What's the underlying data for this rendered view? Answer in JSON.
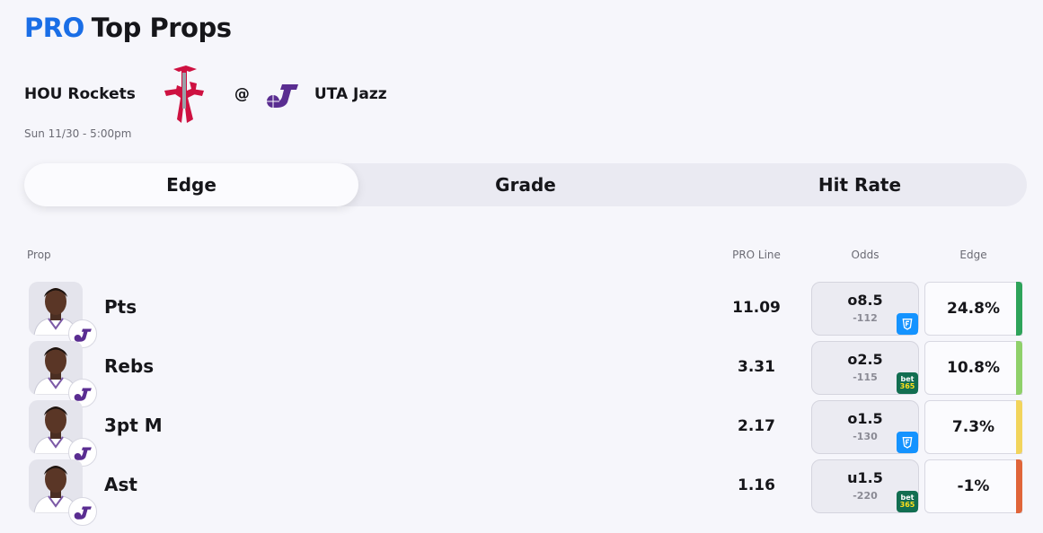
{
  "header": {
    "pro_label": "PRO",
    "title": "Top Props"
  },
  "matchup": {
    "home_team": "HOU Rockets",
    "separator": "@",
    "away_team": "UTA Jazz",
    "datetime": "Sun 11/30 - 5:00pm"
  },
  "tabs": [
    {
      "label": "Edge",
      "active": true
    },
    {
      "label": "Grade",
      "active": false
    },
    {
      "label": "Hit Rate",
      "active": false
    }
  ],
  "table": {
    "columns": {
      "prop": "Prop",
      "pro_line": "PRO Line",
      "odds": "Odds",
      "edge": "Edge"
    },
    "rows": [
      {
        "prop": "Pts",
        "pro_line": "11.09",
        "odds_line": "o8.5",
        "odds_price": "-112",
        "book": "fanduel-icon",
        "edge": "24.8%",
        "edge_color": "#2ea35a"
      },
      {
        "prop": "Rebs",
        "pro_line": "3.31",
        "odds_line": "o2.5",
        "odds_price": "-115",
        "book": "bet365-icon",
        "edge": "10.8%",
        "edge_color": "#8fd06a"
      },
      {
        "prop": "3pt M",
        "pro_line": "2.17",
        "odds_line": "o1.5",
        "odds_price": "-130",
        "book": "fanduel-icon",
        "edge": "7.3%",
        "edge_color": "#f2d45c"
      },
      {
        "prop": "Ast",
        "pro_line": "1.16",
        "odds_line": "u1.5",
        "odds_price": "-220",
        "book": "bet365-icon",
        "edge": "-1%",
        "edge_color": "#e0653a"
      }
    ]
  },
  "bet365_logo": {
    "line1": "bet",
    "line2": "365"
  },
  "colors": {
    "accent": "#1a6ee6",
    "rockets_red": "#ce1141",
    "jazz_purple": "#5a2d91"
  }
}
